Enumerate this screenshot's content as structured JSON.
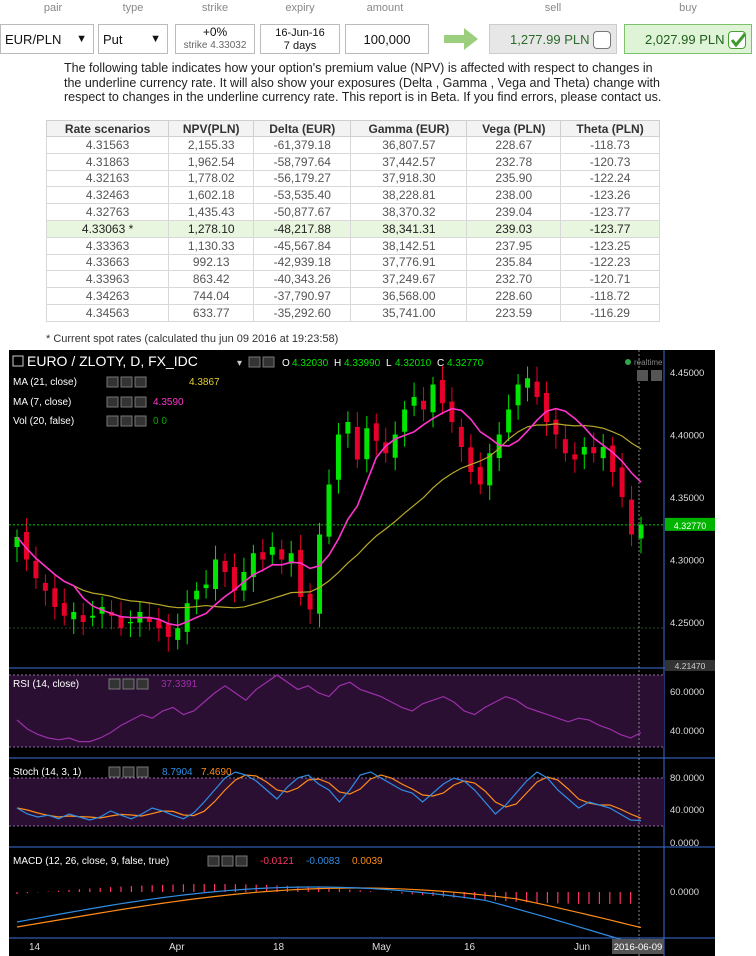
{
  "headers": {
    "pair": "pair",
    "type": "type",
    "strike": "strike",
    "expiry": "expiry",
    "amount": "amount",
    "sell": "sell",
    "buy": "buy"
  },
  "controls": {
    "pair": "EUR/PLN",
    "type": "Put",
    "strike_offset": "+0%",
    "strike_value": "strike 4.33032",
    "expiry_date": "16-Jun-16",
    "expiry_days": "7 days",
    "amount": "100,000",
    "sell_price": "1,277.99 PLN",
    "buy_price": "2,027.99 PLN"
  },
  "description": "The following table indicates how your option's premium value (NPV) is affected with respect to changes in the underline currency rate. It will also show your exposures (Delta , Gamma , Vega and Theta) change with respect to changes in the underline currency rate. This report is in Beta. If you find errors, please contact us.",
  "table": {
    "columns": [
      "Rate scenarios",
      "NPV(PLN)",
      "Delta (EUR)",
      "Gamma (EUR)",
      "Vega (PLN)",
      "Theta (PLN)"
    ],
    "rows": [
      [
        "4.31563",
        "2,155.33",
        "-61,379.18",
        "36,807.57",
        "228.67",
        "-118.73"
      ],
      [
        "4.31863",
        "1,962.54",
        "-58,797.64",
        "37,442.57",
        "232.78",
        "-120.73"
      ],
      [
        "4.32163",
        "1,778.02",
        "-56,179.27",
        "37,918.30",
        "235.90",
        "-122.24"
      ],
      [
        "4.32463",
        "1,602.18",
        "-53,535.40",
        "38,228.81",
        "238.00",
        "-123.26"
      ],
      [
        "4.32763",
        "1,435.43",
        "-50,877.67",
        "38,370.32",
        "239.04",
        "-123.77"
      ],
      [
        "4.33063 *",
        "1,278.10",
        "-48,217.88",
        "38,341.31",
        "239.03",
        "-123.77"
      ],
      [
        "4.33363",
        "1,130.33",
        "-45,567.84",
        "38,142.51",
        "237.95",
        "-123.25"
      ],
      [
        "4.33663",
        "992.13",
        "-42,939.18",
        "37,776.91",
        "235.84",
        "-122.23"
      ],
      [
        "4.33963",
        "863.42",
        "-40,343.26",
        "37,249.67",
        "232.70",
        "-120.71"
      ],
      [
        "4.34263",
        "744.04",
        "-37,790.97",
        "36,568.00",
        "228.60",
        "-118.72"
      ],
      [
        "4.34563",
        "633.77",
        "-35,292.60",
        "35,741.00",
        "223.59",
        "-116.29"
      ]
    ],
    "current_row": 5,
    "note": "* Current spot rates (calculated thu jun 09 2016 at 19:23:58)"
  },
  "chart": {
    "symbol": "EURO / ZLOTY, D, FX_IDC",
    "o_label": "O",
    "o": "4.32030",
    "h_label": "H",
    "h": "4.33990",
    "l_label": "L",
    "l": "4.32010",
    "c_label": "C",
    "c": "4.32770",
    "realtime": "realtime",
    "ma21_label": "MA (21, close)",
    "ma21_value": "4.3867",
    "ma7_label": "MA (7, close)",
    "ma7_value": "4.3590",
    "vol_label": "Vol (20, false)",
    "vol_value": "0  0",
    "rsi_label": "RSI (14, close)",
    "rsi_value": "37.3391",
    "stoch_label": "Stoch (14, 3, 1)",
    "stoch_k": "8.7904",
    "stoch_d": "7.4690",
    "macd_label": "MACD (12, 26, close, 9, false, true)",
    "macd_hist": "-0.0121",
    "macd_line": "-0.0083",
    "macd_signal": "0.0039",
    "price_ticks": [
      "4.45000",
      "4.40000",
      "4.35000",
      "4.30000",
      "4.25000"
    ],
    "last_price_tag": "4.32770",
    "bottom_price_tag": "4.21470",
    "rsi_ticks": [
      "60.0000",
      "40.0000"
    ],
    "stoch_ticks": [
      "80.0000",
      "40.0000",
      "0.0000"
    ],
    "macd_ticks": [
      "0.0000"
    ],
    "x_ticks": [
      "14",
      "Apr",
      "18",
      "May",
      "16",
      "Jun"
    ],
    "x_date_tag": "2016-06-09",
    "colors": {
      "up": "#00e600",
      "down": "#e8002a",
      "ma7": "#ff33cc",
      "ma21": "#b8a82a",
      "rsi": "#9b2fa8",
      "stoch_k": "#2f8de4",
      "stoch_d": "#ff8c1a",
      "macd": "#2f8de4",
      "signal": "#ff8c1a",
      "band": "#2a0f33"
    }
  }
}
